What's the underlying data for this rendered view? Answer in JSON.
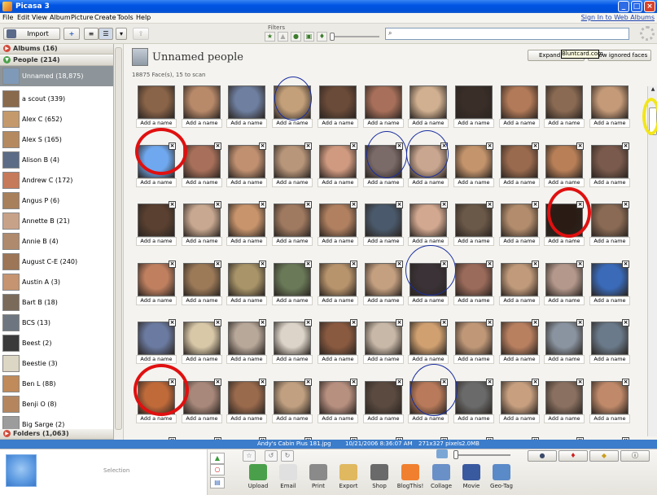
{
  "window": {
    "title": "Picasa 3"
  },
  "menu": {
    "items": [
      "File",
      "Edit",
      "View",
      "Album",
      "Picture",
      "Create",
      "Tools",
      "Help"
    ],
    "sign_in": "Sign In to Web Albums"
  },
  "toolbar": {
    "import_label": "Import",
    "filters_label": "Filters"
  },
  "search": {
    "placeholder": ""
  },
  "sidebar": {
    "albums": "Albums (16)",
    "people": "People (214)",
    "folders": "Folders (1,063)",
    "items": [
      {
        "label": "Unnamed (18,875)",
        "color": "#7f9ab8"
      },
      {
        "label": "a scout (339)",
        "color": "#8a6a4c"
      },
      {
        "label": "Alex C (652)",
        "color": "#c49a6c"
      },
      {
        "label": "Alex S (165)",
        "color": "#b58a60"
      },
      {
        "label": "Alison B (4)",
        "color": "#5c6c86"
      },
      {
        "label": "Andrew C (172)",
        "color": "#c67a5a"
      },
      {
        "label": "Angus P (6)",
        "color": "#a9805c"
      },
      {
        "label": "Annette B (21)",
        "color": "#c8a288"
      },
      {
        "label": "Annie B (4)",
        "color": "#b08a6c"
      },
      {
        "label": "August C-E (240)",
        "color": "#9c7656"
      },
      {
        "label": "Austin A (3)",
        "color": "#c69470"
      },
      {
        "label": "Bart B (18)",
        "color": "#7a6a5a"
      },
      {
        "label": "BCS (13)",
        "color": "#6d7680"
      },
      {
        "label": "Beest (2)",
        "color": "#3a3a3a"
      },
      {
        "label": "Beestie (3)",
        "color": "#dcd6c4"
      },
      {
        "label": "Ben L (88)",
        "color": "#c08a5a"
      },
      {
        "label": "Benji O (8)",
        "color": "#b5865e"
      },
      {
        "label": "Big Sarge (2)",
        "color": "#9c9c9c"
      }
    ]
  },
  "main": {
    "title": "Unnamed people",
    "subtitle": "18875 Face(s), 15 to scan",
    "expand_label": "Expand",
    "show_ignored_label": "Show ignored faces",
    "tooltip": "Bluntcard.com",
    "add_name_label": "Add a name",
    "face_colors": [
      [
        "#8a6448",
        "#b98a6a",
        "#6e7fa0",
        "#c4a07a",
        "#6a4a38",
        "#a8705a",
        "#d0b090",
        "#3a2e28",
        "#b27a58",
        "#8a6a52",
        "#c49a78"
      ],
      [
        "#6fa8ee",
        "#a8705a",
        "#c09070",
        "#b8967a",
        "#d09a80",
        "#7a6a68",
        "#c9a690",
        "#c4946c",
        "#9a6a4e",
        "#b98058",
        "#7a5a4c"
      ],
      [
        "#5a4030",
        "#c8a890",
        "#c8946c",
        "#a07a60",
        "#b08060",
        "#4a5a6c",
        "#d2a890",
        "#6a5848",
        "#b28c6c",
        "#2a1c14",
        "#8a6a54"
      ],
      [
        "#c08060",
        "#9c7a58",
        "#a89468",
        "#6a7a58",
        "#b8946c",
        "#c4a080",
        "#3a3236",
        "#9a6a5a",
        "#c09a7a",
        "#b4988c",
        "#3a6ab8"
      ],
      [
        "#6a7aa0",
        "#d8c8a8",
        "#b8a89a",
        "#dcd4c8",
        "#8a5a40",
        "#c8b8a8",
        "#d0a070",
        "#c09878",
        "#b98060",
        "#8a94a0",
        "#6a7a8a"
      ],
      [
        "#c06a3a",
        "#a8887a",
        "#9a6a4c",
        "#c0a080",
        "#b89080",
        "#5a4a40",
        "#b87a5a",
        "#6a6a6a",
        "#c8a080",
        "#8a7060",
        "#c08a6a"
      ],
      [
        "#4a3a30",
        "#9c6a50",
        "#a07a60",
        "#d0a890",
        "#8a7060",
        "#b89074",
        "#c09878",
        "#7a6a5a",
        "#b49070",
        "#a07060",
        "#6a5448"
      ]
    ]
  },
  "status": {
    "file": "Andy's Cabin Pius 181.jpg",
    "date": "10/21/2006 8:36:07 AM",
    "dims": "271x327 pixels",
    "size": "2.0MB"
  },
  "tray": {
    "selection_label": "Selection",
    "tools": [
      {
        "label": "Upload",
        "icon": "upload-icon",
        "color": "#4aa04a"
      },
      {
        "label": "Email",
        "icon": "email-icon",
        "color": "#e0e0e0"
      },
      {
        "label": "Print",
        "icon": "print-icon",
        "color": "#8a8a8a"
      },
      {
        "label": "Export",
        "icon": "export-icon",
        "color": "#e0b860"
      },
      {
        "label": "Shop",
        "icon": "shop-icon",
        "color": "#6a6a6a"
      },
      {
        "label": "BlogThis!",
        "icon": "blog-icon",
        "color": "#f08030"
      },
      {
        "label": "Collage",
        "icon": "collage-icon",
        "color": "#6a90c8"
      },
      {
        "label": "Movie",
        "icon": "movie-icon",
        "color": "#3a5aa0"
      },
      {
        "label": "Geo-Tag",
        "icon": "geotag-icon",
        "color": "#5a8ac8"
      }
    ]
  },
  "colors": {
    "accent": "#0054E3",
    "status_bar": "#3B7CCB",
    "selected_sidebar": "#8D959A"
  }
}
